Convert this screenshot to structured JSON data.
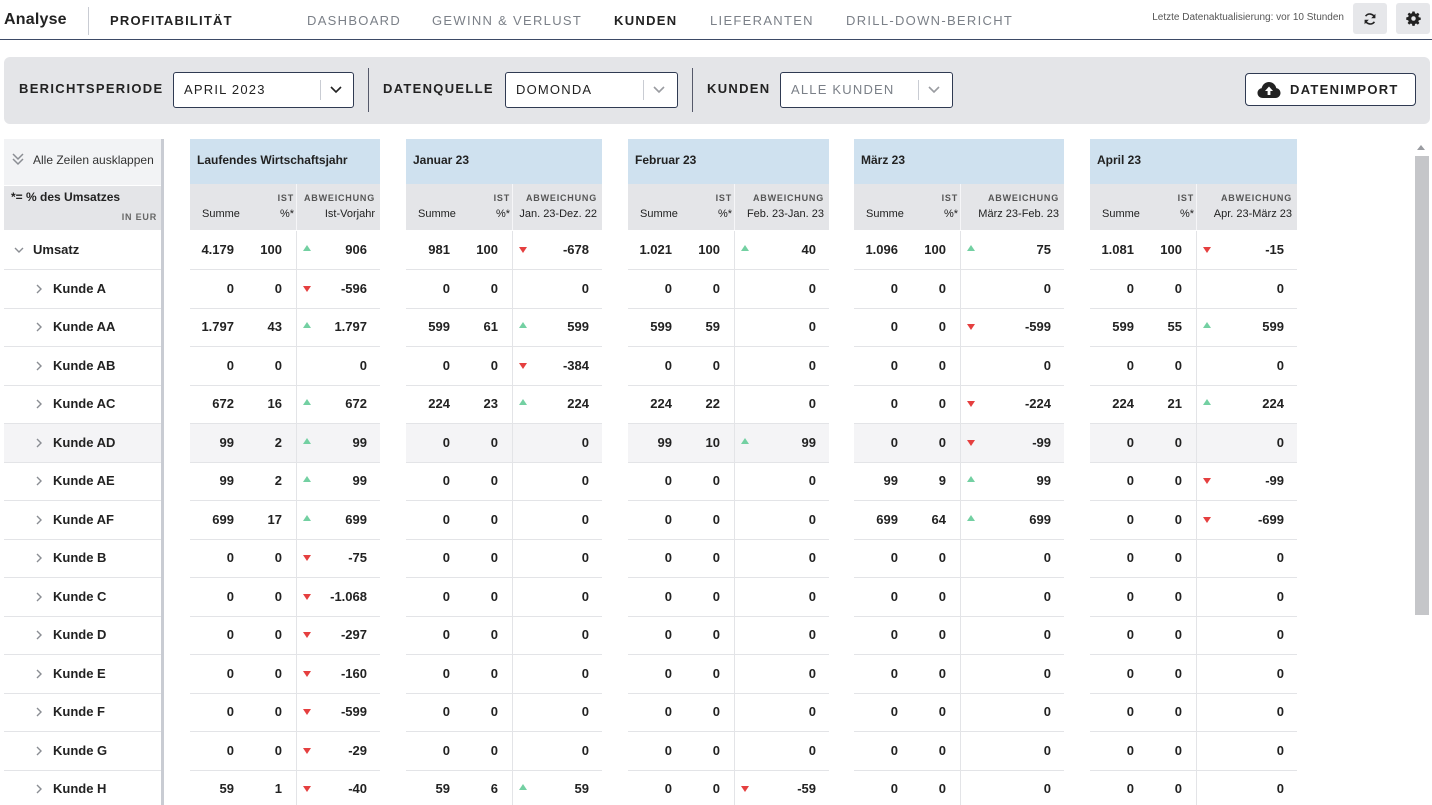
{
  "header": {
    "app_title": "Analyse",
    "section_title": "PROFITABILITÄT",
    "tabs": [
      {
        "label": "DASHBOARD",
        "active": false
      },
      {
        "label": "GEWINN & VERLUST",
        "active": false
      },
      {
        "label": "KUNDEN",
        "active": true
      },
      {
        "label": "LIEFERANTEN",
        "active": false
      },
      {
        "label": "DRILL-DOWN-BERICHT",
        "active": false
      }
    ],
    "last_update": "Letzte Datenaktualisierung: vor 10 Stunden",
    "refresh_icon": "refresh-icon",
    "settings_icon": "gear-icon"
  },
  "filters": {
    "period_label": "BERICHTSPERIODE",
    "period_value": "APRIL 2023",
    "source_label": "DATENQUELLE",
    "source_value": "DOMONDA",
    "customers_label": "KUNDEN",
    "customers_value": "ALLE KUNDEN",
    "import_label": "DATENIMPORT",
    "import_icon": "cloud-upload-icon"
  },
  "table": {
    "expand_all": "Alle Zeilen ausklappen",
    "legend": "*= % des Umsatzes",
    "currency": "IN EUR",
    "sub_sum": "Summe",
    "sub_ist": "IST",
    "sub_pct": "%*",
    "sub_dev": "ABWEICHUNG",
    "colors": {
      "up": "#73d0a2",
      "down": "#e53f3f",
      "header": "#cfe1ef"
    },
    "rows": [
      "Umsatz",
      "Kunde A",
      "Kunde AA",
      "Kunde AB",
      "Kunde AC",
      "Kunde AD",
      "Kunde AE",
      "Kunde AF",
      "Kunde B",
      "Kunde C",
      "Kunde D",
      "Kunde E",
      "Kunde F",
      "Kunde G",
      "Kunde H"
    ],
    "blocks": [
      {
        "title": "Laufendes Wirtschaftsjahr",
        "dev_label": "Ist-Vorjahr",
        "cells": [
          [
            "4.179",
            "100",
            "up",
            "906"
          ],
          [
            "0",
            "0",
            "down",
            "-596"
          ],
          [
            "1.797",
            "43",
            "up",
            "1.797"
          ],
          [
            "0",
            "0",
            "",
            "0"
          ],
          [
            "672",
            "16",
            "up",
            "672"
          ],
          [
            "99",
            "2",
            "up",
            "99"
          ],
          [
            "99",
            "2",
            "up",
            "99"
          ],
          [
            "699",
            "17",
            "up",
            "699"
          ],
          [
            "0",
            "0",
            "down",
            "-75"
          ],
          [
            "0",
            "0",
            "down",
            "-1.068"
          ],
          [
            "0",
            "0",
            "down",
            "-297"
          ],
          [
            "0",
            "0",
            "down",
            "-160"
          ],
          [
            "0",
            "0",
            "down",
            "-599"
          ],
          [
            "0",
            "0",
            "down",
            "-29"
          ],
          [
            "59",
            "1",
            "down",
            "-40"
          ]
        ]
      },
      {
        "title": "Januar 23",
        "dev_label": "Jan. 23-Dez. 22",
        "cells": [
          [
            "981",
            "100",
            "down",
            "-678"
          ],
          [
            "0",
            "0",
            "",
            "0"
          ],
          [
            "599",
            "61",
            "up",
            "599"
          ],
          [
            "0",
            "0",
            "down",
            "-384"
          ],
          [
            "224",
            "23",
            "up",
            "224"
          ],
          [
            "0",
            "0",
            "",
            "0"
          ],
          [
            "0",
            "0",
            "",
            "0"
          ],
          [
            "0",
            "0",
            "",
            "0"
          ],
          [
            "0",
            "0",
            "",
            "0"
          ],
          [
            "0",
            "0",
            "",
            "0"
          ],
          [
            "0",
            "0",
            "",
            "0"
          ],
          [
            "0",
            "0",
            "",
            "0"
          ],
          [
            "0",
            "0",
            "",
            "0"
          ],
          [
            "0",
            "0",
            "",
            "0"
          ],
          [
            "59",
            "6",
            "up",
            "59"
          ]
        ]
      },
      {
        "title": "Februar 23",
        "dev_label": "Feb. 23-Jan. 23",
        "cells": [
          [
            "1.021",
            "100",
            "up",
            "40"
          ],
          [
            "0",
            "0",
            "",
            "0"
          ],
          [
            "599",
            "59",
            "",
            "0"
          ],
          [
            "0",
            "0",
            "",
            "0"
          ],
          [
            "224",
            "22",
            "",
            "0"
          ],
          [
            "99",
            "10",
            "up",
            "99"
          ],
          [
            "0",
            "0",
            "",
            "0"
          ],
          [
            "0",
            "0",
            "",
            "0"
          ],
          [
            "0",
            "0",
            "",
            "0"
          ],
          [
            "0",
            "0",
            "",
            "0"
          ],
          [
            "0",
            "0",
            "",
            "0"
          ],
          [
            "0",
            "0",
            "",
            "0"
          ],
          [
            "0",
            "0",
            "",
            "0"
          ],
          [
            "0",
            "0",
            "",
            "0"
          ],
          [
            "0",
            "0",
            "down",
            "-59"
          ]
        ]
      },
      {
        "title": "März 23",
        "dev_label": "März 23-Feb. 23",
        "cells": [
          [
            "1.096",
            "100",
            "up",
            "75"
          ],
          [
            "0",
            "0",
            "",
            "0"
          ],
          [
            "0",
            "0",
            "down",
            "-599"
          ],
          [
            "0",
            "0",
            "",
            "0"
          ],
          [
            "0",
            "0",
            "down",
            "-224"
          ],
          [
            "0",
            "0",
            "down",
            "-99"
          ],
          [
            "99",
            "9",
            "up",
            "99"
          ],
          [
            "699",
            "64",
            "up",
            "699"
          ],
          [
            "0",
            "0",
            "",
            "0"
          ],
          [
            "0",
            "0",
            "",
            "0"
          ],
          [
            "0",
            "0",
            "",
            "0"
          ],
          [
            "0",
            "0",
            "",
            "0"
          ],
          [
            "0",
            "0",
            "",
            "0"
          ],
          [
            "0",
            "0",
            "",
            "0"
          ],
          [
            "0",
            "0",
            "",
            "0"
          ]
        ]
      },
      {
        "title": "April 23",
        "dev_label": "Apr. 23-März 23",
        "cells": [
          [
            "1.081",
            "100",
            "down",
            "-15"
          ],
          [
            "0",
            "0",
            "",
            "0"
          ],
          [
            "599",
            "55",
            "up",
            "599"
          ],
          [
            "0",
            "0",
            "",
            "0"
          ],
          [
            "224",
            "21",
            "up",
            "224"
          ],
          [
            "0",
            "0",
            "",
            "0"
          ],
          [
            "0",
            "0",
            "down",
            "-99"
          ],
          [
            "0",
            "0",
            "down",
            "-699"
          ],
          [
            "0",
            "0",
            "",
            "0"
          ],
          [
            "0",
            "0",
            "",
            "0"
          ],
          [
            "0",
            "0",
            "",
            "0"
          ],
          [
            "0",
            "0",
            "",
            "0"
          ],
          [
            "0",
            "0",
            "",
            "0"
          ],
          [
            "0",
            "0",
            "",
            "0"
          ],
          [
            "0",
            "0",
            "",
            "0"
          ]
        ]
      }
    ]
  }
}
